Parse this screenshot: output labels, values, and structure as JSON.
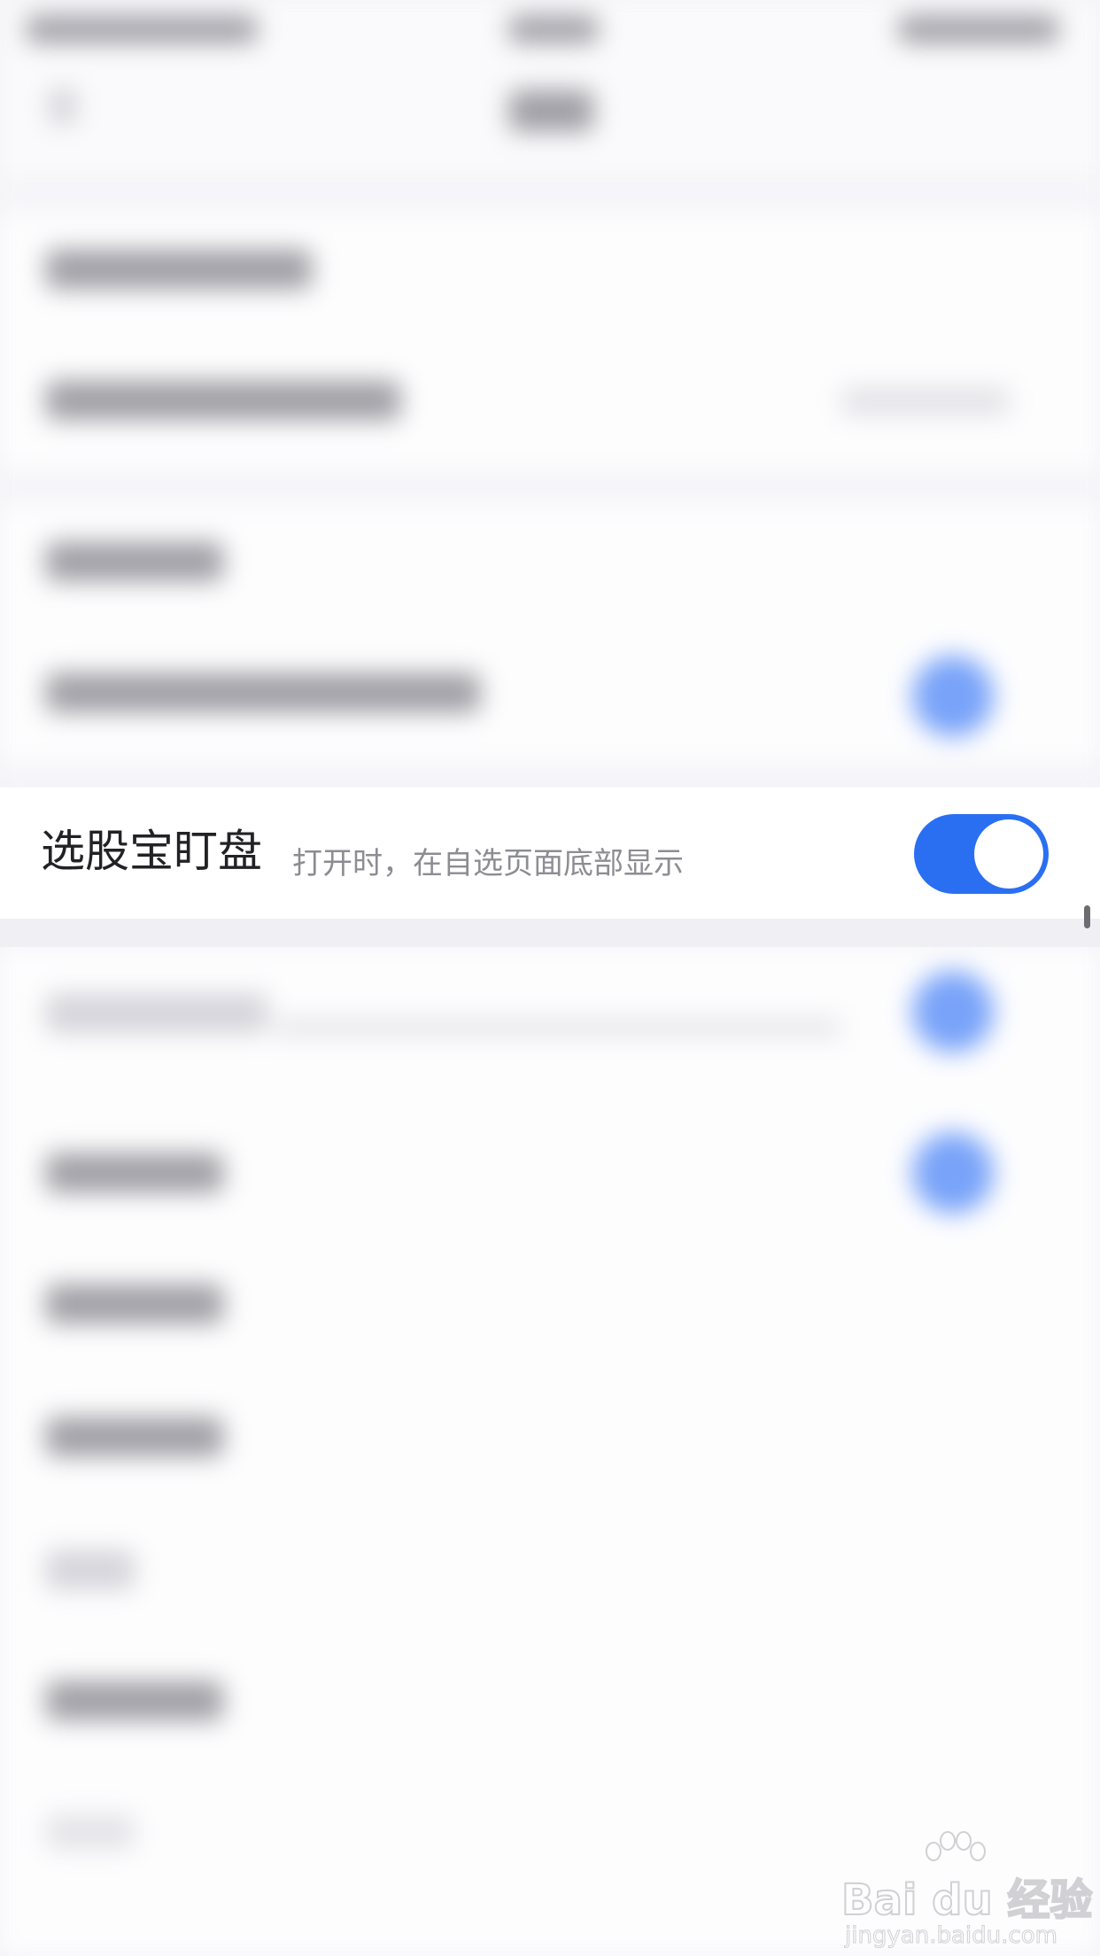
{
  "setting_row": {
    "title": "选股宝盯盘",
    "description": "打开时，在自选页面底部显示",
    "toggle_state": "on"
  },
  "colors": {
    "accent": "#2a6ff2",
    "toggle_knob": "#ffffff"
  },
  "watermark": {
    "text": "Bai du 经验",
    "subtext": "jingyan.baidu.com"
  }
}
